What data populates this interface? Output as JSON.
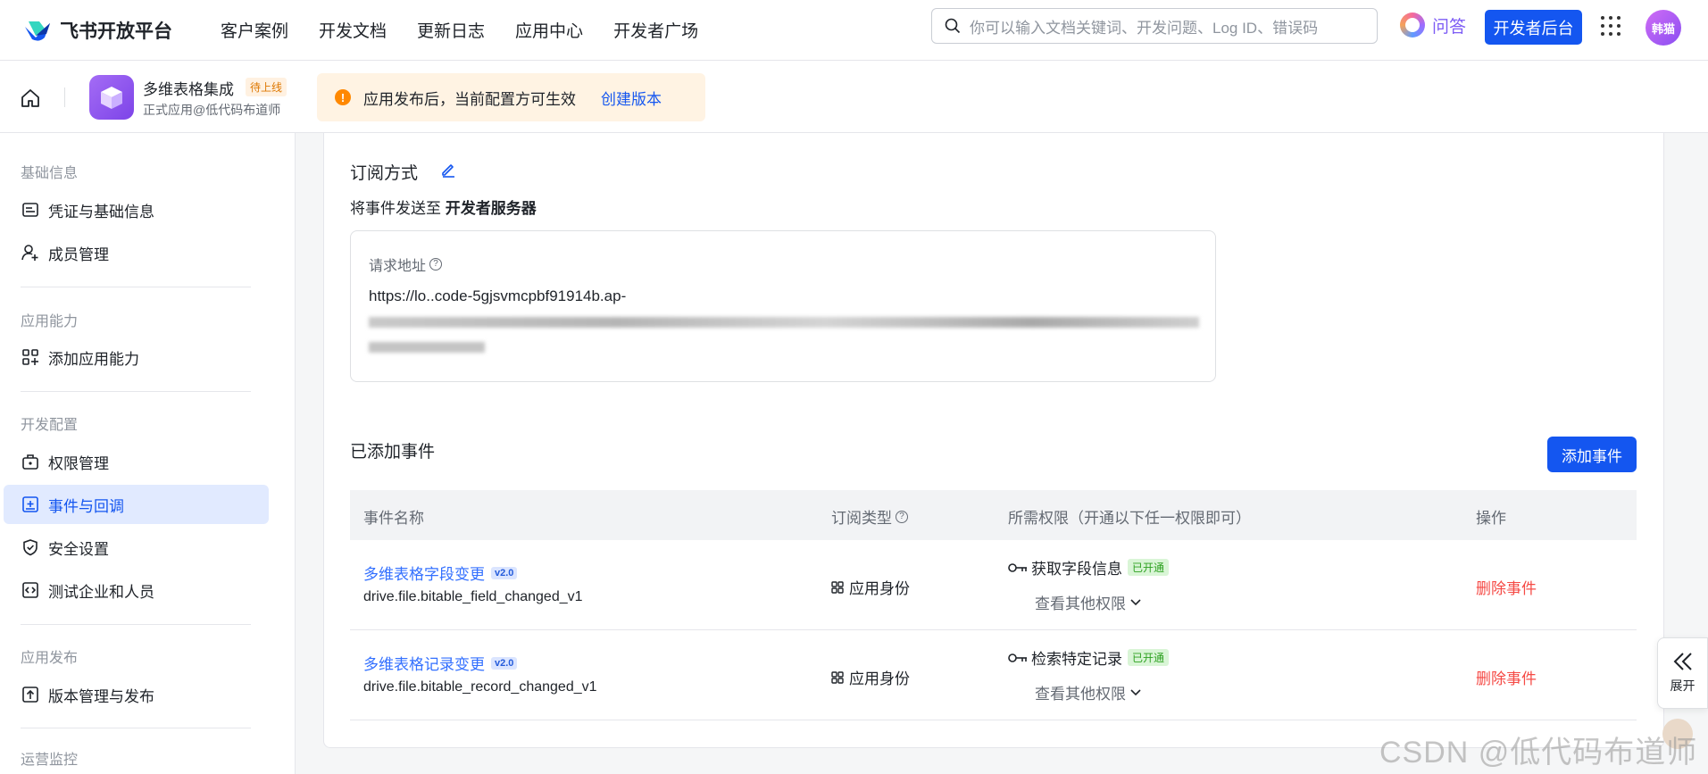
{
  "topnav": {
    "logo_text": "飞书开放平台",
    "links": [
      "客户案例",
      "开发文档",
      "更新日志",
      "应用中心",
      "开发者广场"
    ],
    "search_placeholder": "你可以输入文档关键词、开发问题、Log ID、错误码",
    "ask_label": "问答",
    "dev_console_label": "开发者后台",
    "avatar_text": "韩猫"
  },
  "apphead": {
    "app_name": "多维表格集成",
    "app_tag": "待上线",
    "app_subtitle": "正式应用@低代码布道师",
    "notice_text": "应用发布后，当前配置方可生效",
    "notice_link": "创建版本"
  },
  "sidebar": {
    "groups": [
      {
        "title": "基础信息",
        "items": [
          "凭证与基础信息",
          "成员管理"
        ]
      },
      {
        "title": "应用能力",
        "items": [
          "添加应用能力"
        ]
      },
      {
        "title": "开发配置",
        "items": [
          "权限管理",
          "事件与回调",
          "安全设置",
          "测试企业和人员"
        ]
      },
      {
        "title": "应用发布",
        "items": [
          "版本管理与发布"
        ]
      },
      {
        "title": "运营监控",
        "items": []
      }
    ],
    "active_item": "事件与回调"
  },
  "subscription": {
    "title": "订阅方式",
    "send_to_prefix": "将事件发送至",
    "send_to_target": "开发者服务器",
    "url_label": "请求地址",
    "url_visible": "https://lo..code-5gjsvmcpbf91914b.ap-"
  },
  "events": {
    "title": "已添加事件",
    "add_button": "添加事件",
    "columns": [
      "事件名称",
      "订阅类型",
      "所需权限（开通以下任一权限即可）",
      "操作"
    ],
    "rows": [
      {
        "name": "多维表格字段变更",
        "version": "v2.0",
        "key": "drive.file.bitable_field_changed_v1",
        "type": "应用身份",
        "permission": "获取字段信息",
        "permission_status": "已开通",
        "more": "查看其他权限",
        "action": "删除事件"
      },
      {
        "name": "多维表格记录变更",
        "version": "v2.0",
        "key": "drive.file.bitable_record_changed_v1",
        "type": "应用身份",
        "permission": "检索特定记录",
        "permission_status": "已开通",
        "more": "查看其他权限",
        "action": "删除事件"
      }
    ]
  },
  "side_float": {
    "expand_label": "展开"
  },
  "watermark": "CSDN @低代码布道师",
  "colors": {
    "primary": "#1456f0",
    "danger": "#f54a45",
    "success": "#2ea121",
    "warning": "#ff8800"
  }
}
